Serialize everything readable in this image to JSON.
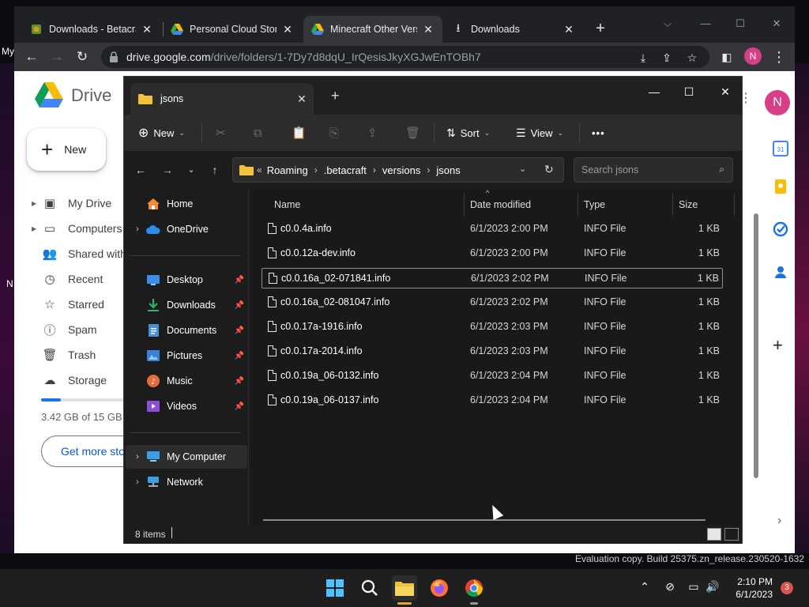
{
  "chrome": {
    "tabs": [
      {
        "title": "Downloads - Betacraf",
        "active": false
      },
      {
        "title": "Personal Cloud Storag",
        "active": false
      },
      {
        "title": "Minecraft Other Versi",
        "active": true
      },
      {
        "title": "Downloads",
        "active": false
      }
    ],
    "url_host": "drive.google.com",
    "url_path": "/drive/folders/1-7Dy7d8dqU_IrQesisJkyXGJwEnTOBh7",
    "avatar_letter": "N",
    "desktop_label_my": "My",
    "desktop_label_n": "N"
  },
  "drive": {
    "title": "Drive",
    "new_label": "New",
    "nav": [
      {
        "label": "My Drive",
        "icon": "my-drive-icon"
      },
      {
        "label": "Computers",
        "icon": "computers-icon"
      },
      {
        "label": "Shared with",
        "icon": "shared-icon"
      },
      {
        "label": "Recent",
        "icon": "clock-icon"
      },
      {
        "label": "Starred",
        "icon": "star-icon"
      },
      {
        "label": "Spam",
        "icon": "spam-icon"
      },
      {
        "label": "Trash",
        "icon": "trash-icon"
      },
      {
        "label": "Storage",
        "icon": "cloud-icon"
      }
    ],
    "storage_text": "3.42 GB of 15 GB",
    "storage_used_fraction": 0.228,
    "get_more_label": "Get more sto",
    "avatar_letter": "N",
    "calendar_day": "31"
  },
  "explorer": {
    "tab_title": "jsons",
    "commands": {
      "new": "New",
      "sort": "Sort",
      "view": "View",
      "more": "•••"
    },
    "breadcrumb": [
      "Roaming",
      ".betacraft",
      "versions",
      "jsons"
    ],
    "breadcrumb_overflow": "«",
    "search_placeholder": "Search jsons",
    "nav": {
      "home": "Home",
      "onedrive": "OneDrive",
      "pinned": [
        {
          "label": "Desktop"
        },
        {
          "label": "Downloads"
        },
        {
          "label": "Documents"
        },
        {
          "label": "Pictures"
        },
        {
          "label": "Music"
        },
        {
          "label": "Videos"
        }
      ],
      "my_computer": "My Computer",
      "network": "Network"
    },
    "columns": {
      "name": "Name",
      "date": "Date modified",
      "type": "Type",
      "size": "Size"
    },
    "files": [
      {
        "name": "c0.0.4a.info",
        "date": "6/1/2023 2:00 PM",
        "type": "INFO File",
        "size": "1 KB"
      },
      {
        "name": "c0.0.12a-dev.info",
        "date": "6/1/2023 2:00 PM",
        "type": "INFO File",
        "size": "1 KB"
      },
      {
        "name": "c0.0.16a_02-071841.info",
        "date": "6/1/2023 2:02 PM",
        "type": "INFO File",
        "size": "1 KB"
      },
      {
        "name": "c0.0.16a_02-081047.info",
        "date": "6/1/2023 2:02 PM",
        "type": "INFO File",
        "size": "1 KB"
      },
      {
        "name": "c0.0.17a-1916.info",
        "date": "6/1/2023 2:03 PM",
        "type": "INFO File",
        "size": "1 KB"
      },
      {
        "name": "c0.0.17a-2014.info",
        "date": "6/1/2023 2:03 PM",
        "type": "INFO File",
        "size": "1 KB"
      },
      {
        "name": "c0.0.19a_06-0132.info",
        "date": "6/1/2023 2:04 PM",
        "type": "INFO File",
        "size": "1 KB"
      },
      {
        "name": "c0.0.19a_06-0137.info",
        "date": "6/1/2023 2:04 PM",
        "type": "INFO File",
        "size": "1 KB"
      }
    ],
    "status_count": "8 items"
  },
  "watermark": "Evaluation copy. Build 25375.zn_release.230520-1632",
  "taskbar": {
    "time": "2:10 PM",
    "date": "6/1/2023",
    "notification_count": "3"
  }
}
